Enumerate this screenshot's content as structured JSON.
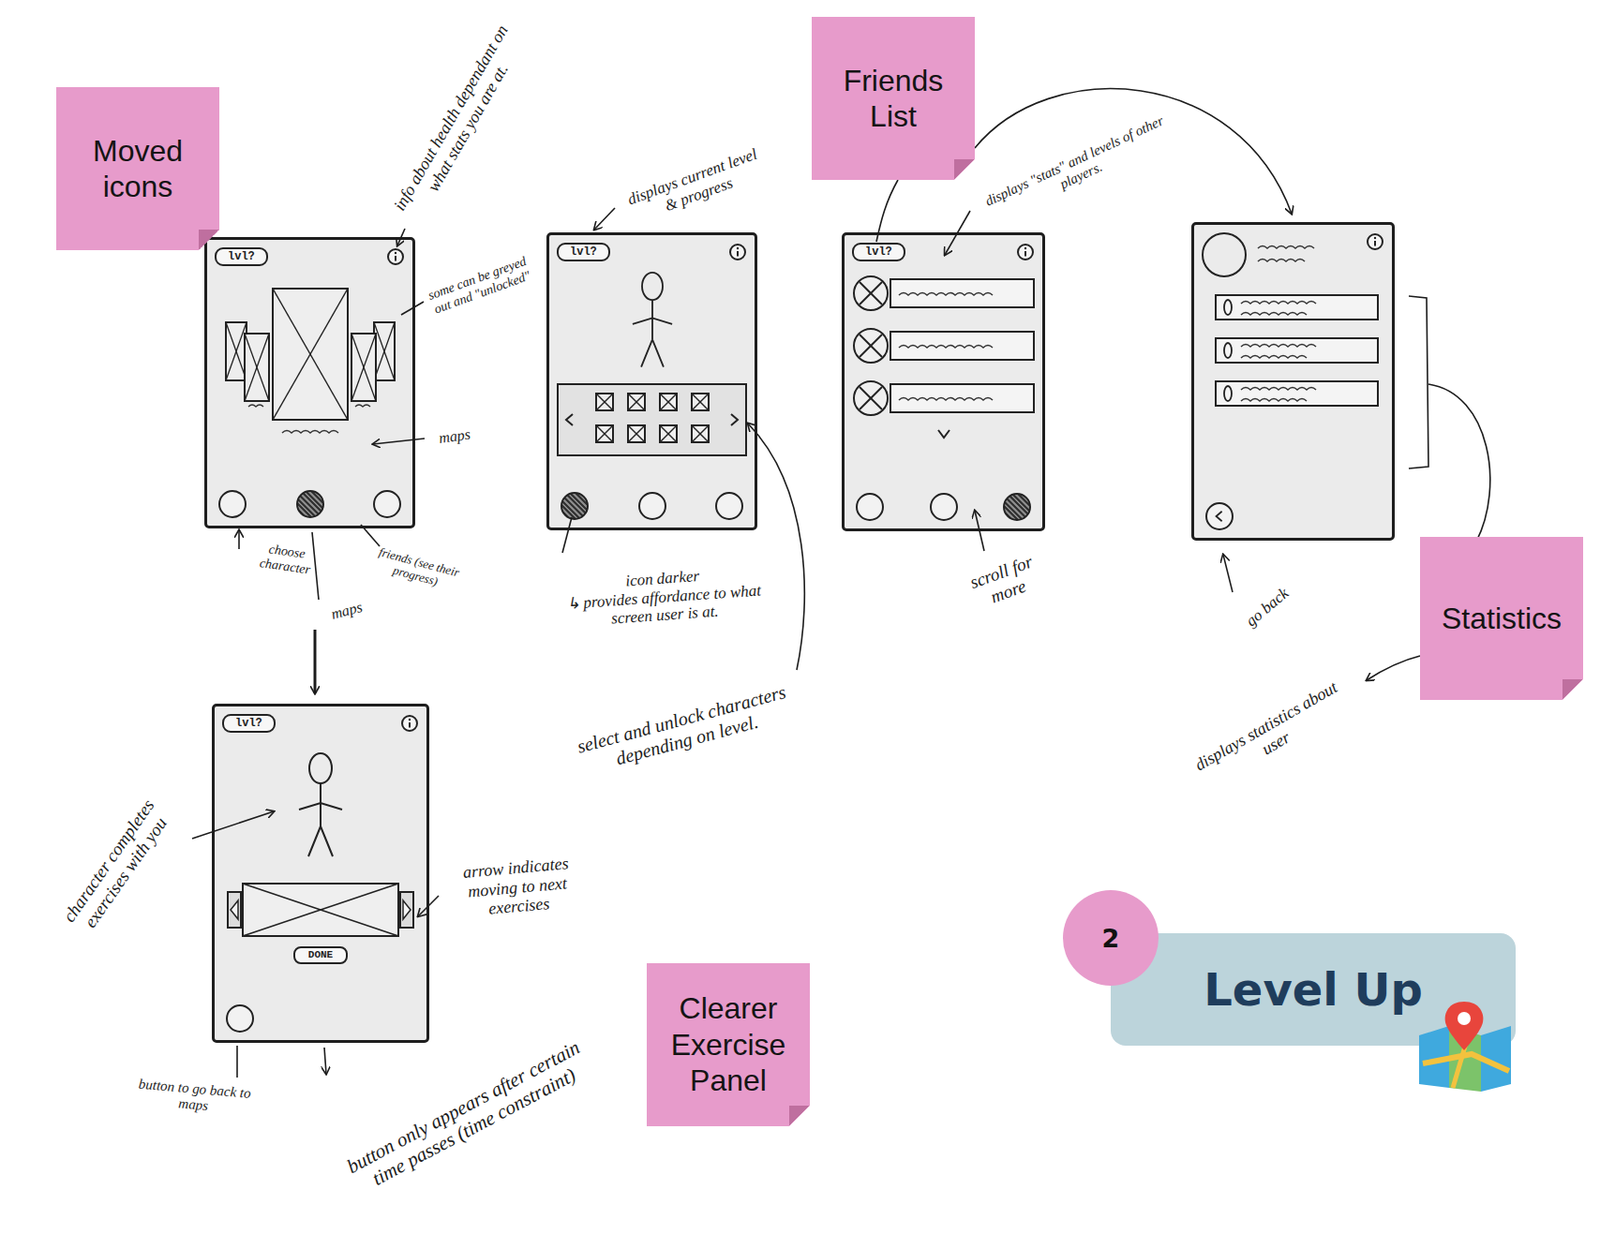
{
  "sticky_notes": [
    {
      "label": "Moved icons"
    },
    {
      "label": "Friends List"
    },
    {
      "label": "Statistics"
    },
    {
      "label": "Clearer Exercise Panel"
    }
  ],
  "screens": {
    "maps": {
      "level_badge": "lvl?",
      "nav": [
        {
          "selected": false
        },
        {
          "selected": true
        },
        {
          "selected": false
        }
      ]
    },
    "characters": {
      "level_badge": "lvl?",
      "slots": [
        {
          "selected": false
        },
        {
          "selected": false
        },
        {
          "selected": false
        },
        {
          "selected": false
        },
        {
          "selected": false
        },
        {
          "selected": false
        },
        {
          "selected": false
        },
        {
          "selected": false
        }
      ],
      "nav": [
        {
          "selected": true
        },
        {
          "selected": false
        },
        {
          "selected": false
        }
      ]
    },
    "friends": {
      "level_badge": "lvl?",
      "nav": [
        {
          "selected": false
        },
        {
          "selected": false
        },
        {
          "selected": true
        }
      ]
    },
    "exercise": {
      "level_badge": "lvl?",
      "done_button": "DONE"
    }
  },
  "annotations": [
    {
      "text": "info about health dependant on what stats you are at."
    },
    {
      "text": "some can be greyed out and \"unlocked\""
    },
    {
      "text": "maps"
    },
    {
      "text": "choose character"
    },
    {
      "text": "maps"
    },
    {
      "text": "friends (see their progress)"
    },
    {
      "text": "displays current level & progress"
    },
    {
      "text": "icon darker\n↳ provides affordance to what screen user is at."
    },
    {
      "text": "select and unlock characters depending on level."
    },
    {
      "text": "displays \"stats\" and levels of other players."
    },
    {
      "text": "scroll for more"
    },
    {
      "text": "go back"
    },
    {
      "text": "displays statistics about user"
    },
    {
      "text": "character completes exercises with you"
    },
    {
      "text": "arrow indicates moving to next exercises"
    },
    {
      "text": "button to go back to maps"
    },
    {
      "text": "button only appears after certain time passes (time constraint)"
    }
  ],
  "badge": {
    "number": "2",
    "label": "Level Up"
  }
}
